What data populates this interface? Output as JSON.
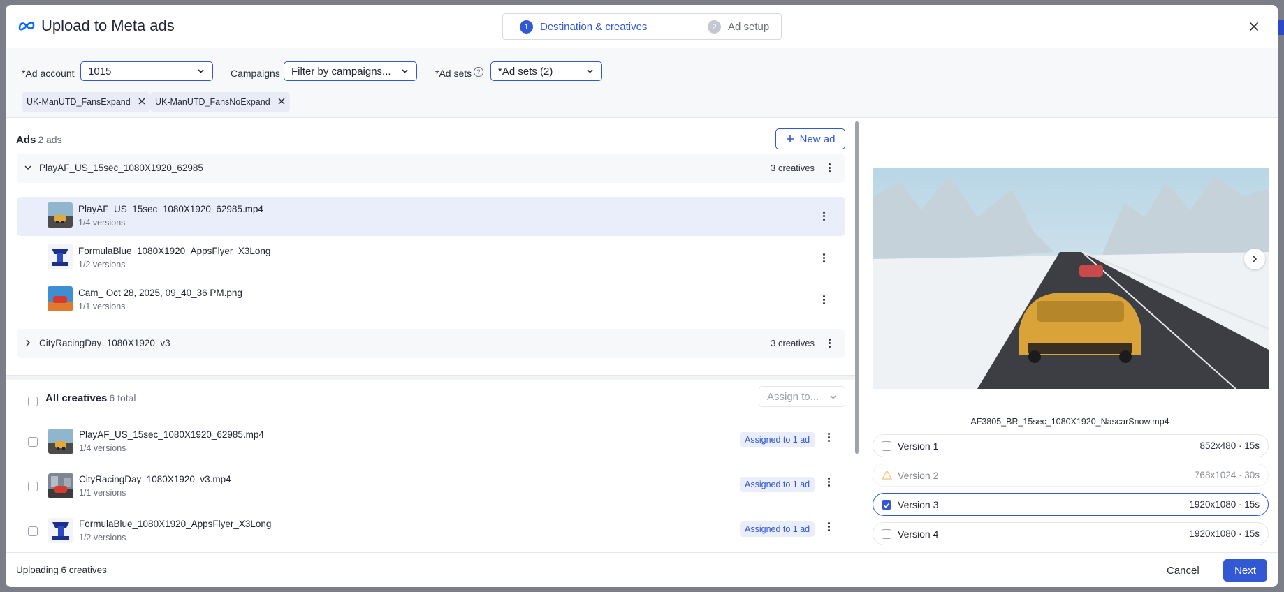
{
  "header": {
    "title": "Upload to Meta ads",
    "steps": [
      {
        "num": "1",
        "label": "Destination & creatives"
      },
      {
        "num": "2",
        "label": "Ad setup"
      }
    ]
  },
  "filters": {
    "ad_account_label": "*Ad account",
    "ad_account_value": "1015",
    "campaigns_label": "Campaigns",
    "campaigns_value": "Filter by campaigns...",
    "ad_sets_label": "*Ad sets",
    "ad_sets_value": "*Ad sets (2)",
    "chips": [
      "UK-ManUTD_FansExpand",
      "UK-ManUTD_FansNoExpand"
    ]
  },
  "ads": {
    "heading": "Ads",
    "count": "2 ads",
    "new_ad_label": "New ad",
    "groups": [
      {
        "name": "PlayAF_US_15sec_1080X1920_62985",
        "count": "3 creatives",
        "creatives": [
          {
            "title": "PlayAF_US_15sec_1080X1920_62985.mp4",
            "versions": "1/4 versions"
          },
          {
            "title": "FormulaBlue_1080X1920_AppsFlyer_X3Long",
            "versions": "1/2 versions"
          },
          {
            "title": "Cam_ Oct 28, 2025, 09_40_36 PM.png",
            "versions": "1/1 versions"
          }
        ]
      },
      {
        "name": "CityRacingDay_1080X1920_v3",
        "count": "3 creatives"
      }
    ]
  },
  "all_creatives": {
    "heading": "All creatives",
    "count": "6 total",
    "assign_label": "Assign to...",
    "rows": [
      {
        "title": "PlayAF_US_15sec_1080X1920_62985.mp4",
        "versions": "1/4 versions",
        "badge": "Assigned to 1 ad"
      },
      {
        "title": "CityRacingDay_1080X1920_v3.mp4",
        "versions": "1/1 versions",
        "badge": "Assigned to 1 ad"
      },
      {
        "title": "FormulaBlue_1080X1920_AppsFlyer_X3Long",
        "versions": "1/2 versions",
        "badge": "Assigned to 1 ad"
      }
    ]
  },
  "preview": {
    "filename": "AF3805_BR_15sec_1080X1920_NascarSnow.mp4",
    "versions": [
      {
        "name": "Version 1",
        "meta": "852x480 · 15s"
      },
      {
        "name": "Version 2",
        "meta": "768x1024 · 30s"
      },
      {
        "name": "Version 3",
        "meta": "1920x1080 · 15s"
      },
      {
        "name": "Version 4",
        "meta": "1920x1080 · 15s"
      }
    ]
  },
  "footer": {
    "status": "Uploading 6 creatives",
    "cancel_label": "Cancel",
    "next_label": "Next"
  },
  "colors": {
    "accent": "#3358d4",
    "badge_bg": "#eaeefb",
    "warning": "#e8a23b"
  }
}
